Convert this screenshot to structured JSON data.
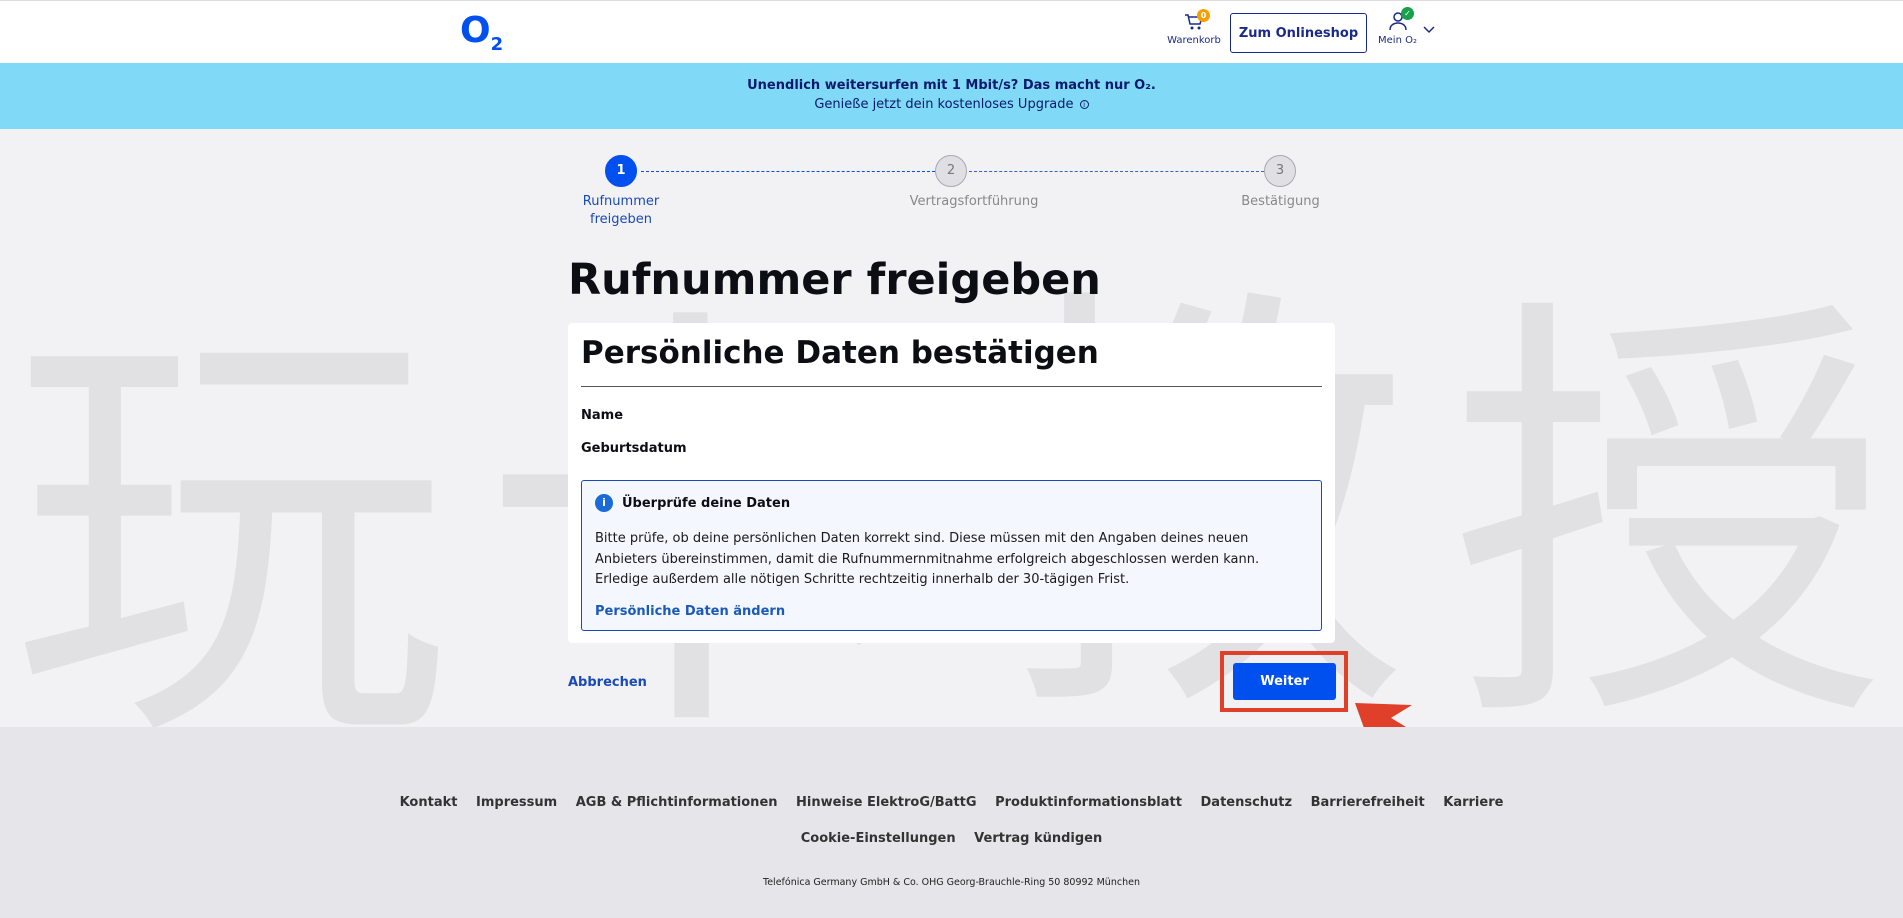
{
  "header": {
    "logo": "O",
    "logo_sub": "2",
    "cart_badge": "0",
    "cart_label": "Warenkorb",
    "shop_button": "Zum Onlineshop",
    "account_badge": "✓",
    "account_label": "Mein O₂"
  },
  "promo": {
    "line1": "Unendlich weitersurfen mit 1 Mbit/s? Das macht nur O₂.",
    "line2": "Genieße jetzt dein kostenloses Upgrade",
    "info_icon": "i"
  },
  "stepper": {
    "steps": [
      {
        "number": "1",
        "label_line1": "Rufnummer",
        "label_line2": "freigeben",
        "state": "active"
      },
      {
        "number": "2",
        "label_line1": "Vertragsfortführung",
        "label_line2": "",
        "state": "inactive"
      },
      {
        "number": "3",
        "label_line1": "Bestätigung",
        "label_line2": "",
        "state": "inactive"
      }
    ]
  },
  "main": {
    "title": "Rufnummer freigeben",
    "card_title": "Persönliche Daten bestätigen",
    "field_name": "Name",
    "field_birthdate": "Geburtsdatum",
    "info": {
      "icon": "i",
      "title": "Überprüfe deine Daten",
      "text": "Bitte prüfe, ob deine persönlichen Daten korrekt sind. Diese müssen mit den Angaben deines neuen Anbieters übereinstimmen, damit die Rufnummernmitnahme erfolgreich abgeschlossen werden kann. Erledige außerdem alle nötigen Schritte rechtzeitig innerhalb der 30-tägigen Frist.",
      "link": "Persönliche Daten ändern"
    },
    "cancel": "Abbrechen",
    "next": "Weiter"
  },
  "watermark": {
    "chars": [
      "玩",
      "卡",
      "教",
      "授"
    ]
  },
  "footer": {
    "links_row1": [
      "Kontakt",
      "Impressum",
      "AGB & Pflichtinformationen",
      "Hinweise ElektroG/BattG",
      "Produktinformationsblatt",
      "Datenschutz",
      "Barrierefreiheit",
      "Karriere"
    ],
    "links_row2": [
      "Cookie-Einstellungen",
      "Vertrag kündigen"
    ],
    "copyright": "Telefónica Germany GmbH & Co. OHG Georg-Brauchle-Ring 50 80992 München"
  },
  "colors": {
    "brand_blue": "#0050f0",
    "promo_bg": "#7fd9f7",
    "highlight_red": "#e0402a"
  }
}
